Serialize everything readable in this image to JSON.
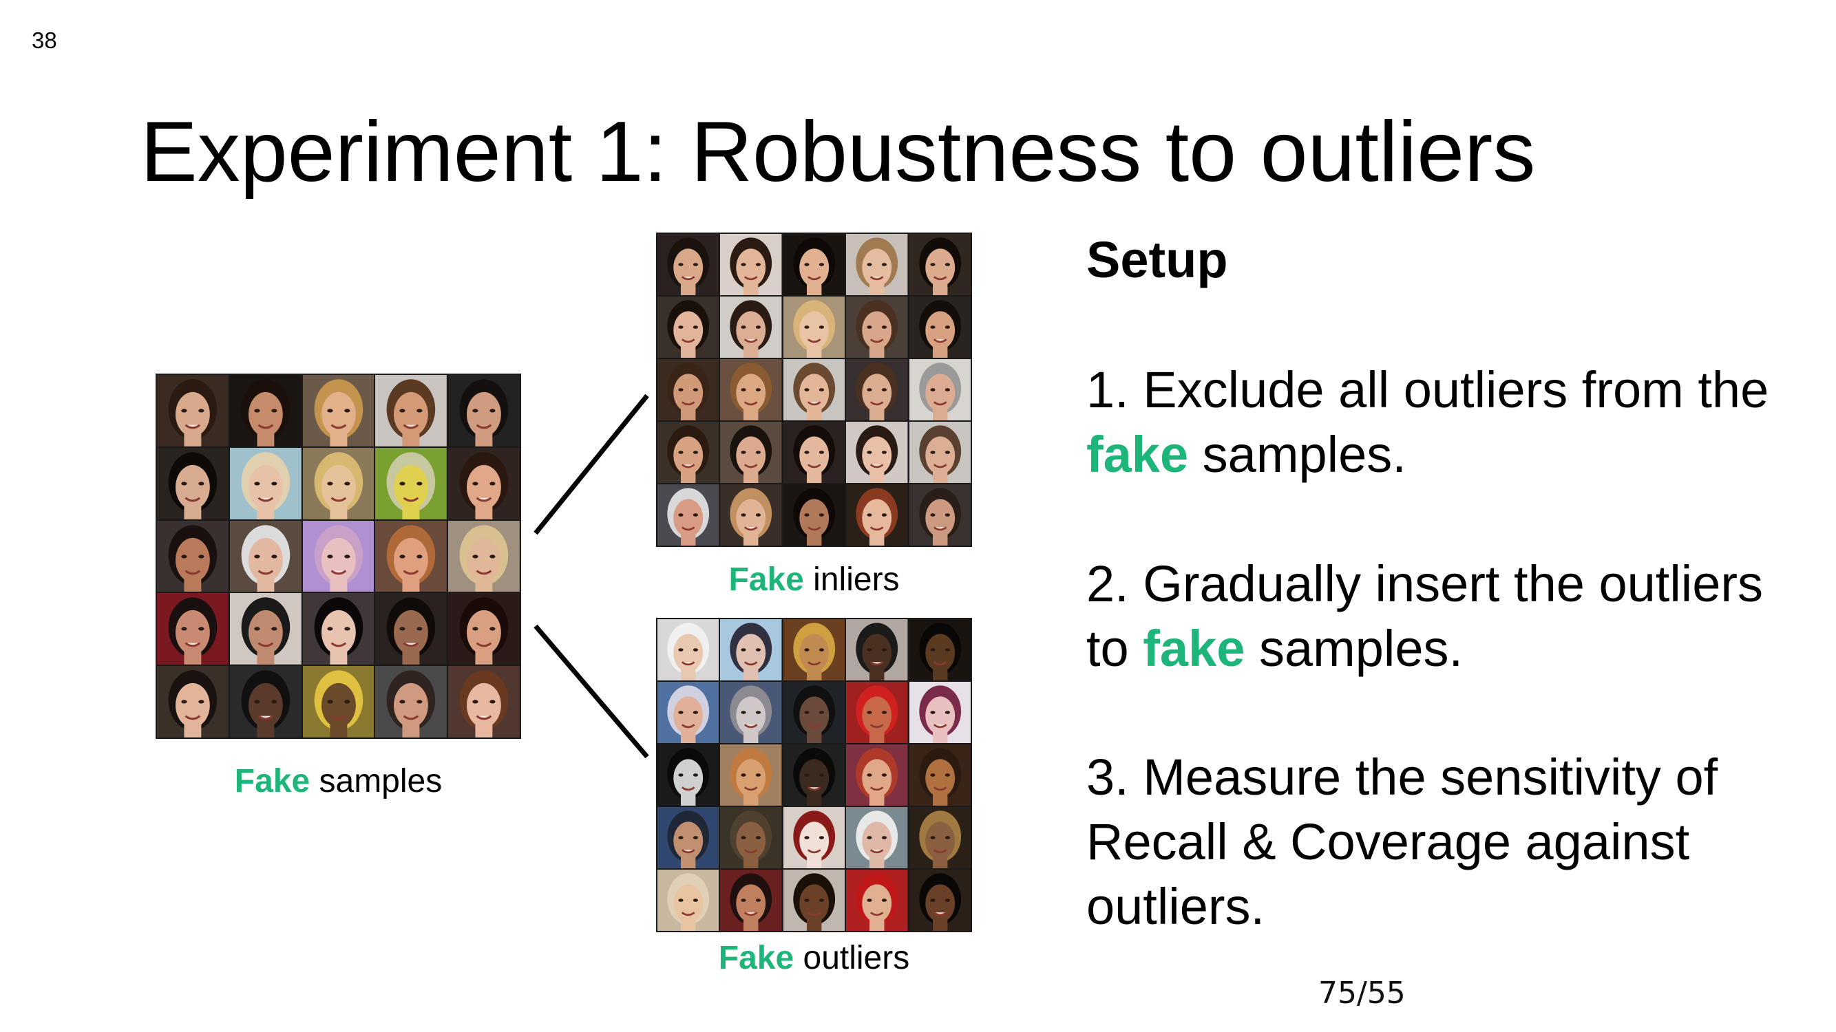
{
  "slide_number": "38",
  "title": "Experiment 1: Robustness to outliers",
  "accent_color": "#1db57a",
  "captions": {
    "samples": {
      "accent": "Fake",
      "rest": " samples"
    },
    "inliers": {
      "accent": "Fake",
      "rest": " inliers"
    },
    "outliers": {
      "accent": "Fake",
      "rest": " outliers"
    }
  },
  "setup": {
    "heading": "Setup",
    "step1": {
      "before": "1. Exclude all outliers from the ",
      "accent": "fake",
      "after": " samples."
    },
    "step2": {
      "before": "2. Gradually insert the outliers to ",
      "accent": "fake",
      "after": " samples."
    },
    "step3": {
      "text": "3. Measure the sensitivity of Recall & Coverage against outliers."
    }
  },
  "page_counter": "75/55",
  "faces": {
    "samples": [
      {
        "bg": "#3a2a22",
        "skin": "#d8a98a",
        "hair": "#2a1a12"
      },
      {
        "bg": "#1a1512",
        "skin": "#c58b6a",
        "hair": "#1a0f0a"
      },
      {
        "bg": "#6b5a4a",
        "skin": "#e2b08a",
        "hair": "#c4944e"
      },
      {
        "bg": "#c9c4c0",
        "skin": "#d49a78",
        "hair": "#5a3a22"
      },
      {
        "bg": "#222222",
        "skin": "#cf9c80",
        "hair": "#151010"
      },
      {
        "bg": "#2a2420",
        "skin": "#d8ac90",
        "hair": "#0e0a08"
      },
      {
        "bg": "#9fc1cc",
        "skin": "#e8c2a8",
        "hair": "#e0d0b0"
      },
      {
        "bg": "#8a7a5a",
        "skin": "#e6c29a",
        "hair": "#d8b870"
      },
      {
        "bg": "#7aa030",
        "skin": "#e0d050",
        "hair": "#c8c8a0"
      },
      {
        "bg": "#302420",
        "skin": "#e0a888",
        "hair": "#2a1810"
      },
      {
        "bg": "#3a3030",
        "skin": "#b87a5a",
        "hair": "#1a1010"
      },
      {
        "bg": "#5a4a40",
        "skin": "#e2b8a0",
        "hair": "#dcdcdc"
      },
      {
        "bg": "#b090d0",
        "skin": "#e8c0c0",
        "hair": "#c8a0c8"
      },
      {
        "bg": "#6a4a3a",
        "skin": "#e0a080",
        "hair": "#b06a3a"
      },
      {
        "bg": "#a09080",
        "skin": "#e0b898",
        "hair": "#d8c090"
      },
      {
        "bg": "#7a1a20",
        "skin": "#c88a70",
        "hair": "#1a1010"
      },
      {
        "bg": "#d0c8c0",
        "skin": "#c08a70",
        "hair": "#1a1a1a"
      },
      {
        "bg": "#403838",
        "skin": "#e8c4b0",
        "hair": "#0a0808"
      },
      {
        "bg": "#2a2220",
        "skin": "#9a6a50",
        "hair": "#100a08"
      },
      {
        "bg": "#2a1a18",
        "skin": "#d8a080",
        "hair": "#1a0a08"
      },
      {
        "bg": "#3a3028",
        "skin": "#e2b49a",
        "hair": "#1a1210"
      },
      {
        "bg": "#2a2a2a",
        "skin": "#5a3a2a",
        "hair": "#101010"
      },
      {
        "bg": "#8a7a30",
        "skin": "#6a4a2a",
        "hair": "#e0c040"
      },
      {
        "bg": "#4a4a4a",
        "skin": "#d09a80",
        "hair": "#302420"
      },
      {
        "bg": "#503830",
        "skin": "#e8b8a0",
        "hair": "#6a3a20"
      }
    ],
    "inliers": [
      {
        "bg": "#2a2220",
        "skin": "#d8a888",
        "hair": "#1a120e"
      },
      {
        "bg": "#d8d0c8",
        "skin": "#e2b498",
        "hair": "#2a1a12"
      },
      {
        "bg": "#1a1410",
        "skin": "#e0b090",
        "hair": "#0e0806"
      },
      {
        "bg": "#c8c0b8",
        "skin": "#e4bca0",
        "hair": "#a07a50"
      },
      {
        "bg": "#302820",
        "skin": "#dcaa8c",
        "hair": "#120c08"
      },
      {
        "bg": "#3a302a",
        "skin": "#e2b49a",
        "hair": "#1a100a"
      },
      {
        "bg": "#d0ccc8",
        "skin": "#dcae94",
        "hair": "#2a1c14"
      },
      {
        "bg": "#a89478",
        "skin": "#e8c4a4",
        "hair": "#d8b478"
      },
      {
        "bg": "#4a4038",
        "skin": "#d8a688",
        "hair": "#4a3020"
      },
      {
        "bg": "#2a2420",
        "skin": "#d6a282",
        "hair": "#140e0a"
      },
      {
        "bg": "#3a2a20",
        "skin": "#d09a78",
        "hair": "#3a2418"
      },
      {
        "bg": "#6a5040",
        "skin": "#dca884",
        "hair": "#8a5a30"
      },
      {
        "bg": "#c8c4c0",
        "skin": "#e4b698",
        "hair": "#6a4a30"
      },
      {
        "bg": "#383030",
        "skin": "#dcae90",
        "hair": "#4a3020"
      },
      {
        "bg": "#d8d4d0",
        "skin": "#dcac92",
        "hair": "#9a9a9a"
      },
      {
        "bg": "#3a3028",
        "skin": "#d8a282",
        "hair": "#2a1a10"
      },
      {
        "bg": "#5a4a40",
        "skin": "#dcaa8e",
        "hair": "#1a120c"
      },
      {
        "bg": "#2a2220",
        "skin": "#e4b89c",
        "hair": "#140c08"
      },
      {
        "bg": "#d0c8c4",
        "skin": "#e8c0a8",
        "hair": "#2a1a14"
      },
      {
        "bg": "#c8c4c0",
        "skin": "#dcae94",
        "hair": "#5a4030"
      },
      {
        "bg": "#4a4a50",
        "skin": "#d89c84",
        "hair": "#d8d8d8"
      },
      {
        "bg": "#3a2e28",
        "skin": "#e2b496",
        "hair": "#c09060"
      },
      {
        "bg": "#1a1412",
        "skin": "#b07a5a",
        "hair": "#0e0806"
      },
      {
        "bg": "#2a2018",
        "skin": "#e6b89c",
        "hair": "#8a3a20"
      },
      {
        "bg": "#3a3230",
        "skin": "#cc9a80",
        "hair": "#2a1e18"
      }
    ],
    "outliers": [
      {
        "bg": "#d8d8d8",
        "skin": "#e8c8b0",
        "hair": "#f0f0f0"
      },
      {
        "bg": "#a8c8e0",
        "skin": "#e0c0b0",
        "hair": "#303040"
      },
      {
        "bg": "#6a4020",
        "skin": "#c08a50",
        "hair": "#d0a040"
      },
      {
        "bg": "#b0a8a0",
        "skin": "#4a3020",
        "hair": "#1a1a1a"
      },
      {
        "bg": "#1a1410",
        "skin": "#5a3a20",
        "hair": "#0a0806"
      },
      {
        "bg": "#5070a0",
        "skin": "#e0b098",
        "hair": "#d0d0e0"
      },
      {
        "bg": "#4a5878",
        "skin": "#d0c8c8",
        "hair": "#8a8a90"
      },
      {
        "bg": "#202428",
        "skin": "#6a4a3a",
        "hair": "#101010"
      },
      {
        "bg": "#a02020",
        "skin": "#c86a4a",
        "hair": "#d02020"
      },
      {
        "bg": "#e8e0e8",
        "skin": "#e8c0c0",
        "hair": "#7a2a4a"
      },
      {
        "bg": "#1a1a1a",
        "skin": "#d0d0d0",
        "hair": "#0a0a0a"
      },
      {
        "bg": "#a08060",
        "skin": "#d8a070",
        "hair": "#c07a40"
      },
      {
        "bg": "#202020",
        "skin": "#3a2a20",
        "hair": "#0a0a0a"
      },
      {
        "bg": "#803040",
        "skin": "#e0a888",
        "hair": "#b03a2a"
      },
      {
        "bg": "#3a2418",
        "skin": "#b07040",
        "hair": "#2a1a10"
      },
      {
        "bg": "#304870",
        "skin": "#c09070",
        "hair": "#202838"
      },
      {
        "bg": "#3a3428",
        "skin": "#8a6040",
        "hair": "#504030"
      },
      {
        "bg": "#d8d0c8",
        "skin": "#f0e0d8",
        "hair": "#8a1a1a"
      },
      {
        "bg": "#7a8a90",
        "skin": "#e0b8a8",
        "hair": "#e8e8e8"
      },
      {
        "bg": "#2a2018",
        "skin": "#8a6040",
        "hair": "#a07a40"
      },
      {
        "bg": "#c8b8a0",
        "skin": "#e8c4a0",
        "hair": "#e0d0b8"
      },
      {
        "bg": "#6a2020",
        "skin": "#c08060",
        "hair": "#201010"
      },
      {
        "bg": "#c0b8b0",
        "skin": "#6a4028",
        "hair": "#1a1008"
      },
      {
        "bg": "#b02020",
        "skin": "#e0b090",
        "hair": "#c01818"
      },
      {
        "bg": "#2a2018",
        "skin": "#6a4028",
        "hair": "#0a0806"
      }
    ]
  }
}
